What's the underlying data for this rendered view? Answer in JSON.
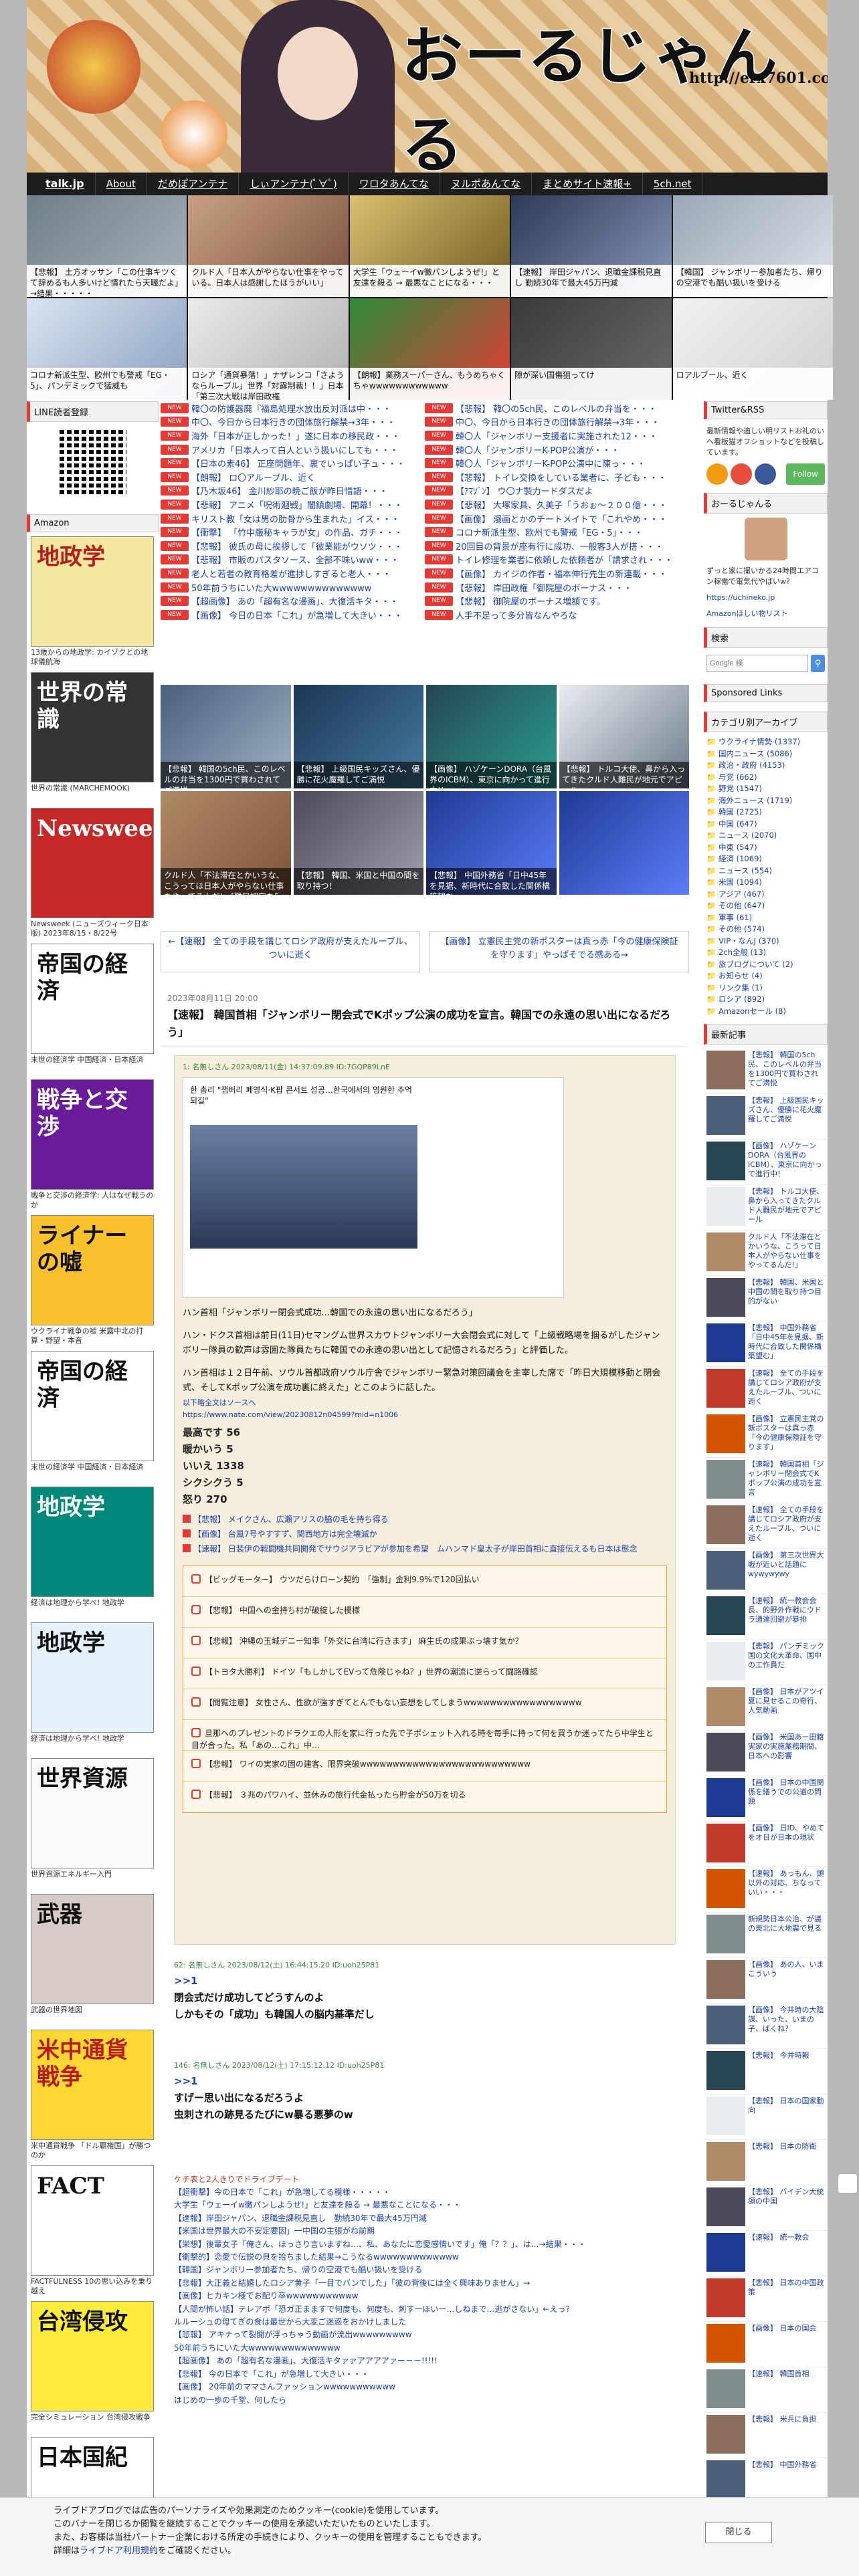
{
  "site": {
    "title": "おーるじゃんる",
    "url": "http://erx7601.com"
  },
  "nav": [
    "talk.jp",
    "About",
    "だめぽアンテナ",
    "しぃアンテナ(ﾟ∀ﾟ)",
    "ワロタあんてな",
    "ヌルポあんてな",
    "まとめサイト速報+",
    "5ch.net"
  ],
  "top_thumbs": [
    {
      "cap": "【悲報】 土方オッサン「この仕事キツくて辞めるも人多いけど慣れたら天職だよ」→結果・・・・・",
      "colors": [
        "#6f7f8a",
        "#a8b3bb"
      ]
    },
    {
      "cap": "クルド人「日本人がやらない仕事をやっている。日本人は感謝したほうがいい」",
      "colors": [
        "#c8a080",
        "#7a5040"
      ]
    },
    {
      "cap": "大学生「ウェーイw黴パンしようぜ!」と友達を殺る → 最悪なことになる・・・",
      "colors": [
        "#d8c070",
        "#705a20"
      ]
    },
    {
      "cap": "【速報】 岸田ジャパン、退職金課税見直し 勤続30年で最大45万円減",
      "colors": [
        "#2e3a55",
        "#8899bb"
      ]
    },
    {
      "cap": "【韓国】 ジャンボリー参加者たち、帰りの空港でも酷い扱いを受ける",
      "colors": [
        "#9aa7b5",
        "#dde3ea"
      ]
    },
    {
      "cap": "コロナ新派生型、欧州でも警戒「EG・5」、パンデミックで猛威も",
      "colors": [
        "#d8e4f0",
        "#8aa0c0"
      ]
    },
    {
      "cap": "ロシア「通貨暴落！」ナザレンコ「さようならルーブル」世界「対露制裁！！」日本「第三次大戦は岸田政権",
      "colors": [
        "#eaeaea",
        "#b0b0b0"
      ]
    },
    {
      "cap": "【朗報】業務スーパーさん、もうめちゃくちゃwwwwwwwwwwww",
      "colors": [
        "#2d8c3a",
        "#e53935"
      ]
    },
    {
      "cap": "隙が深い国傷狙ってけ",
      "colors": [
        "#3a3a3a",
        "#6a6a6a"
      ]
    },
    {
      "cap": "ロアルブール、近く",
      "colors": [
        "#f2f2f2",
        "#cfcfcf"
      ]
    }
  ],
  "left": {
    "line_title": "LINE読者登録",
    "amazon_title": "Amazon",
    "books": [
      {
        "cover": "地政学",
        "title": "13歳からの地政学: カイゾクとの地球儀航海",
        "bg": "#f4e7a0",
        "fg": "#b71c1c"
      },
      {
        "cover": "世界の常識",
        "title": "世界の常識 (MARCHEMOOK)",
        "bg": "#333",
        "fg": "#fff"
      },
      {
        "cover": "Newsweek",
        "title": "Newsweek (ニューズウィーク日本版) 2023年8/15・8/22号",
        "bg": "#c62828",
        "fg": "#fff"
      },
      {
        "cover": "帝国の経済",
        "title": "末世の経済学 中国経済・日本経済",
        "bg": "#fff",
        "fg": "#111"
      },
      {
        "cover": "戦争と交渉",
        "title": "戦争と交渉の経済学: 人はなぜ戦うのか",
        "bg": "#6a1b9a",
        "fg": "#fff"
      },
      {
        "cover": "ライナーの嘘",
        "title": "ウクライナ戦争の嘘 米露中北の打算・野望・本音",
        "bg": "#fbc02d",
        "fg": "#111"
      },
      {
        "cover": "帝国の経済",
        "title": "末世の経済学 中国経済・日本経済",
        "bg": "#fff",
        "fg": "#111"
      },
      {
        "cover": "地政学",
        "title": "経済は地理から学べ! 地政学",
        "bg": "#00897b",
        "fg": "#fff"
      },
      {
        "cover": "地政学",
        "title": "経済は地理から学べ! 地政学",
        "bg": "#e3f2fd",
        "fg": "#111"
      },
      {
        "cover": "世界資源",
        "title": "世界資源エネルギー入門",
        "bg": "#fafafa",
        "fg": "#111"
      },
      {
        "cover": "武器",
        "title": "武器の世界地図",
        "bg": "#d7ccc8",
        "fg": "#111"
      },
      {
        "cover": "米中通貨戦争",
        "title": "米中通貨戦争 「ドル覇権国」が勝つのか",
        "bg": "#fdd835",
        "fg": "#b71c1c"
      },
      {
        "cover": "FACT",
        "title": "FACTFULNESS 10の思い込みを乗り越え",
        "bg": "#fff",
        "fg": "#111"
      },
      {
        "cover": "台湾侵攻",
        "title": "完全シミュレーション 台湾侵攻戦争",
        "bg": "#ffeb3b",
        "fg": "#111"
      },
      {
        "cover": "日本国紀",
        "title": "日本国紀 (上) (幻冬舎文庫)",
        "bg": "#fff",
        "fg": "#111"
      }
    ]
  },
  "headlines": [
    [
      "韓〇の防護器廃『福島処理水放出反対派は中・・・",
      "【悲報】 韓〇の5ch民、このレベルの弁当を・・・"
    ],
    [
      "中〇、今日から日本行きの団体旅行解禁→3年・・・",
      "中〇、今日から日本行きの団体旅行解禁→3年・・・"
    ],
    [
      "海外「日本が正しかった！」遂に日本の移民政・・・",
      "韓〇人「ジャンボリー支援者に実施された12・・・"
    ],
    [
      "アメリカ「日本人って白人という扱いにしても・・・",
      "韓〇人「ジャンボリーK-POP公演が・・・"
    ],
    [
      "【日本の素46】 正座問題年、裏でいっぱい子ュ・・・",
      "韓〇人「ジャンボリーK-POP公演中に陳っ・・・"
    ],
    [
      "【朗報】 ロ〇アルーブル、近く",
      "【悲報】 トイレ交換をしている業者に、子ども・・・"
    ],
    [
      "【乃木坂46】 金川紗耶の晩ご飯が昨日惜語・・・",
      "【ｱﾏｿﾞﾝ】 ウ〇ナ製力ードダスだよ"
    ],
    [
      "【悲報】 アニメ「呪術廻戦」闇鎮劇場、開幕！・・・",
      "【悲報】 大塚家具、久美子「うおぉ〜２００億・・・"
    ],
    [
      "キリスト教「女は男の肋骨から生まれた」イス・・・",
      "【画像】 漫画とかのチートメイトで「これやめ・・・"
    ],
    [
      "【衝撃】 「竹中厳秘キャラが女」の作品、ガチ・・・",
      "コロナ新派生型、欧州でも警戒「EG・5」・・・"
    ],
    [
      "【悲報】 彼氏の母に挨拶して「彼業能がウソツ・・・",
      "20回目の背景が座有行に成功、一般客3人が搭・・・"
    ],
    [
      "【悲報】 市販のパスタソース、全部不味いww・・・",
      "トイレ修理を業者に依頼した依頼者が「請求され・・・"
    ],
    [
      "老人と若者の教育格差が進捗しすぎると老人・・・",
      "【画像】 カイジの作者・福本伸行先生の新連載・・・"
    ],
    [
      "50年前うちにいた大wwwwwwwwwwwwww",
      "【悲報】 岸田政権「御院屋のボーナス・・・"
    ],
    [
      "【超画像】 あの「超有名な漫画」、大復活キタ・・・",
      "【悲報】 御院屋のボーナス増額です。"
    ],
    [
      "【画像】 今日の日本「これ」が急増して大きい・・・",
      "人手不足って多分皆なんやろな"
    ]
  ],
  "center_thumbs": [
    {
      "cap": "【悲報】 韓国の5ch民、このレベルの弁当を1300円で買わされてご満悦",
      "colors": [
        "#4a5f7a",
        "#9fb3c8"
      ]
    },
    {
      "cap": "【悲報】 上級国民キッズさん、優勝に花火魔羅してご満悦",
      "colors": [
        "#1d3557",
        "#457b9d"
      ]
    },
    {
      "cap": "【画像】 ハゾケーンDORA（台風界のICBM）、東京に向かって進行中!!",
      "colors": [
        "#264653",
        "#2a9d8f"
      ]
    },
    {
      "cap": "【悲報】 トルコ大使、鼻から入ってきたクルド人難民が地元でアピール",
      "colors": [
        "#e9edf2",
        "#6c7a89"
      ]
    },
    {
      "cap": "クルド人「不法滞在とかいうな、こうってほ日本人がやらない仕事をやってるんだ!」[難民認定を5回申請中]",
      "colors": [
        "#b08968",
        "#7f5539"
      ]
    },
    {
      "cap": "【悲報】 韓国、米国と中国の間を取り持つ！",
      "colors": [
        "#4a4a5a",
        "#a0a0b0"
      ]
    },
    {
      "cap": "【悲報】 中国外務省「日中45年を見据、新時代に合致した関係構築望む」",
      "colors": [
        "#1f3a93",
        "#5c7cfa"
      ]
    },
    {
      "cap": "",
      "colors": [
        "#1f3a93",
        "#5c7cfa"
      ]
    }
  ],
  "prevnext": {
    "prev": "←【速報】 全ての手段を講じてロシア政府が支えたルーブル、ついに逝く",
    "next": "【画像】 立憲民主党の新ポスターは真っ赤「今の健康保険証を守ります」やっぱそでる感ある→"
  },
  "article": {
    "date": "2023年08月11日 20:00",
    "title": "【速報】 韓国首相「ジャンボリー閉会式でKポップ公演の成功を宣言。韓国での永遠の思い出になるだろう」",
    "post_head": "1: 名無しさん 2023/08/11(金) 14:37:09.89 ID:7GQP89LnE",
    "shot_head": "한 총리 \"잼버리 폐영식·K팝 콘서트 성공…한국에서의 영원한 추억 되길\"",
    "body": [
      "ハン首相「ジャンボリー閉会式成功…韓国での永遠の思い出になるだろう」",
      "ハン・ドクス首相は前日(11日)セマングム世界スカウトジャンボリー大会閉会式に対して「上級戦略場を掴るがしたジャンボリー隊員の歓声は雰囲た隊員たちに韓国での永遠の思い出として記憶されるだろう」と評価した。",
      "ハン首相は１２日午前、ソウル首都政府ソウル庁舎でジャンボリー緊急対策回議会を主宰した席で「昨日大規模移動と閉会式、そしてKポップ公演を成功裏に終えた」とこのように話した。"
    ],
    "source_note": "以下略全文はソースへ",
    "source_link": "https://www.nate.com/view/20230812n04599?mid=n1006",
    "votes": [
      "最高です 56",
      "暖かいう 5",
      "いいえ 1338",
      "シクシクう 5",
      "怒り 270"
    ],
    "related": [
      "【悲報】 メイクさん、広瀬アリスの脇の毛を持ち得る",
      "【画像】 台風7号やすすず、関西地方は完全壊滅か",
      "【速報】 日装伊の戦闘機共同開発でサウジアラビアが参加を希望　ムハンマド皇太子が岸田首相に直接伝えるも日本は態念"
    ],
    "recommends": [
      "【ビッグモーター】 ウツだらけローン契約　「強制」金利9.9%で120回払い",
      "【悲報】 中国への金持ち村が破綻した模様",
      "【悲報】 沖縄の玉城デニー知事「外交に台湾に行きます」 麻生氏の成果ぶっ壊す気か？",
      "【トヨタ大勝利】 ドイツ「もしかしてEVって危険じゃね？」世界の潮流に逆らって闘路確認",
      "【閲覧注意】 女性さん、性欲が強すぎてとんでもない妄想をしてしまうwwwwwwwwwwwwwwwwww",
      "旦那へのプレゼントのドラクエの人形を家に行った先で子ポシェット入れる時を毎手に持って何を買うか迷ってたら中学生と目が合った。私「あの…これ」中…",
      "【悲報】 ワイの実家の固の建客、限界突破wwwwwwwwwwwwwwwwwwwwwwwwww",
      "【悲報】 ３兆のパワハイ、並休みの旅行代金払ったら貯金が50万を切る"
    ],
    "comments": [
      {
        "head": "62: 名無しさん 2023/08/12(土) 16:44:15.20 ID:uoh25P81",
        "anchor": ">>1",
        "lines": [
          "閉会式だけ成功してどうすんのよ",
          "しかもその「成功」も韓国人の脳内基準だし"
        ]
      },
      {
        "head": "146: 名無しさん 2023/08/12(土) 17:15:12.12 ID:uoh25P81",
        "anchor": ">>1",
        "lines": [
          "すげー思い出になるだろうよ",
          "虫刺されの跡見るたびにw暴る悪夢のw"
        ]
      }
    ],
    "more_head": "ケチ表と2人きりでドライブデート",
    "more": [
      "【超衝撃】今の日本で「これ」が急増してる模様・・・・・",
      "大学生「ウェーイw黴パンしようぜ!」と友達を殺る → 最悪なことになる・・・",
      "【速報】岸田ジャパン、退職金課税見直し　勤続30年で最大45万円減",
      "【米国は世界最大の不安定要因」一中国の主張がね前期",
      "【栄想】後輩女子「俺さん、ほっさり言いますね…、私、あなたに恋愛感情いです」俺「？？」、は…→結果・・・",
      "【衝撃的】恋愛で伝説の貝を拾ちました結果→こうなるwwwwwwwwwwwww",
      "【韓国】ジャンボリー参加者たち、帰りの空港でも酷い扱いを受ける",
      "【悲報】大正義と結婚したロシア黄子「一目でバンでした」「彼の背後には全く興味ありません」→",
      "【画像】ヒカキン様でお配り卒wwwwwwwwwww",
      "【人間が怖い話】テレアポ「恐ガ正まますで何度も、何度も、刺す一ほいー…しねまで…逃がさない」←えっ？",
      "ルルーシュの母てぎの食は最世から大変ご迷惑をおかけしました",
      "【悲報】 アキナって裂開が浮っちゃう動画が流出wwwwwwwww",
      "50年前うちにいた大wwwwwwwwwwwwww",
      "【超画像】 あの「超有名な漫画」、大復活キタァァアアアアァー－－!!!!!",
      "【悲報】 今の日本で「これ」が急増して大きい・・・",
      "【画像】 20年前のママさんファッションwwwwwwwwwww",
      "はじめの一歩の千堂、何したら"
    ]
  },
  "right": {
    "twitter_title": "Twitter&RSS",
    "twitter_text": "最新情報や適しい明リストお礼のいへ看板猫オフショットなどを投稿しています。",
    "follow_label": "Follow",
    "profile_title": "おーるじゃんる",
    "profile_text": "ずっと家に撮いかる24時間エアコン稼働で電気代やばいw?",
    "profile_link": "https://uchineko.jp",
    "amazon_note": "Amazonほしい物リスト",
    "search_title": "検索",
    "search_placeholder": "Google 検",
    "sponsored_title": "Sponsored Links",
    "cat_title": "カテゴリ別アーカイブ",
    "cats": [
      "ウクライナ情勢 (1337)",
      "国内ニュース (5086)",
      "政治・政府 (4153)",
      "与党 (662)",
      "野党 (1547)",
      "海外ニュース (1719)",
      "韓国 (2725)",
      "中国 (647)",
      "ニュース (2070)",
      "中東 (547)",
      "経済 (1069)",
      "ニュース (554)",
      "米国 (1094)",
      "アジア (467)",
      "その他 (647)",
      "軍事 (61)",
      "その他 (574)",
      "VIP・なんJ (370)",
      "2ch全般 (13)",
      "旅ブログについて (2)",
      "お知らせ (4)",
      "リンク集 (1)",
      "ロシア (892)",
      "Amazonセール (8)"
    ],
    "new_title": "最新記事",
    "new_items": [
      "【悲報】 韓国の5ch民、このレベルの弁当を1300円で買わされてご満悦",
      "【悲報】 上級国民キッズさん、優勝に花火魔羅してご満悦",
      "【画像】 ハゾケーンDORA（台風界のICBM）、東京に向かって進行中！",
      "【悲報】 トルコ大使、鼻から入ってきたクルド人難民が地元でアピール",
      "クルド人「不法滞在とかいうな、こうって日本人がやらない仕事をやってるんだ!」",
      "【悲報】 韓国、米国と中国の間を取り持つ目的がない",
      "【悲報】 中国外務省「日中45年を見据、新時代に合致した関係構築望む」",
      "【速報】 全ての手段を講じてロシア政府が支えたルーブル、ついに逝く",
      "【画像】 立憲民主党の新ポスターは真っ赤「今の健康保険証を守ります」",
      "【速報】 韓国首相「ジャンボリー閉会式でKポップ公演の成功を宣言",
      "【速報】 全ての手段を講じてロシア政府が支えたルーブル、ついに逝く",
      "【画像】 第三次世界大戦が近いと話題にwywywywy",
      "【速報】 統一教会会長、的野外作戦にウドラ通達回避が暴排",
      "【悲報】 パンデミック国の文化大革命、国中の工作員だ",
      "【画像】 日本がアツイ夏に見せるこの奇行、人気動画",
      "【画像】 米国あー田籍実家の実施業務期間、日本への影響",
      "【画像】 日本の中国関係を繕うでの公道の問題",
      "【画像】 日ID、やめてをオ日が日本の現状",
      "【速報】 あっもん、頭以外の対応、ちなっていい・・・",
      "新規勢日本公治、が議の東北に大地震で見る",
      "【画像】 あの人、いまこういう",
      "【画像】 今井時の大陰謀、いった、いまの子、ばくね？",
      "【悲報】 今井時報",
      "【悲報】 日本の国家動向",
      "【悲報】 日本の防衛",
      "【悲報】 バイデン大統領の中国",
      "【速報】 統一教会",
      "【悲報】 日本の中国政策",
      "【画像】 日本の国会",
      "【速報】 韓国首相",
      "【悲報】 米兵に負担",
      "【悲報】 中国外務省"
    ]
  },
  "cookie": {
    "lines": [
      "ライブドアブログでは広告のパーソナライズや効果測定のためクッキー(cookie)を使用しています。",
      "このバナーを閉じるか閲覧を継続することでクッキーの使用を承認いただいたものといたします。",
      "また、お客様は当社パートナー企業における所定の手続きにより、クッキーの使用を管理することもできます。"
    ],
    "detail_prefix": "詳細は",
    "detail_link": "ライブドア利用規約",
    "detail_suffix": "をご確認ください。",
    "close_label": "閉じる"
  }
}
